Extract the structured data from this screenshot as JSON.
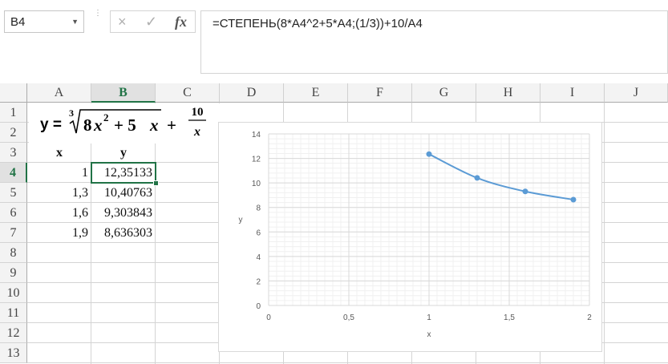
{
  "namebox": {
    "value": "B4",
    "arrow_icon": "chevron-down-icon"
  },
  "formula_bar": {
    "cancel_icon": "×",
    "enter_icon": "✓",
    "fx_label": "fx",
    "formula": "=СТЕПЕНЬ(8*A4^2+5*A4;(1/3))+10/A4"
  },
  "columns": [
    "A",
    "B",
    "C",
    "D",
    "E",
    "F",
    "G",
    "H",
    "I",
    "J"
  ],
  "rows": [
    "1",
    "2",
    "3",
    "4",
    "5",
    "6",
    "7",
    "8",
    "9",
    "10",
    "11",
    "12",
    "13"
  ],
  "selected": {
    "column": "B",
    "row": "4"
  },
  "equation": {
    "lhs": "y =",
    "root_index": "3",
    "radicand_a": "8",
    "var": "x",
    "exp": "2",
    "plus1": "+ 5",
    "plus2": "+",
    "frac_num": "10",
    "frac_den": "x"
  },
  "table": {
    "header_x": "x",
    "header_y": "y",
    "rows": [
      {
        "x": "1",
        "y": "12,35133"
      },
      {
        "x": "1,3",
        "y": "10,40763"
      },
      {
        "x": "1,6",
        "y": "9,303843"
      },
      {
        "x": "1,9",
        "y": "8,636303"
      }
    ]
  },
  "chart_data": {
    "type": "scatter",
    "title": "",
    "xlabel": "x",
    "ylabel": "y",
    "xlim": [
      0,
      2
    ],
    "ylim": [
      0,
      14
    ],
    "xticks": [
      "0",
      "0,5",
      "1",
      "1,5",
      "2"
    ],
    "yticks": [
      "0",
      "2",
      "4",
      "6",
      "8",
      "10",
      "12",
      "14"
    ],
    "grid": true,
    "smooth_line": true,
    "series_color": "#5b9bd5",
    "series": [
      {
        "x": [
          1,
          1.3,
          1.6,
          1.9
        ],
        "y": [
          12.35133,
          10.40763,
          9.303843,
          8.636303
        ]
      }
    ]
  }
}
